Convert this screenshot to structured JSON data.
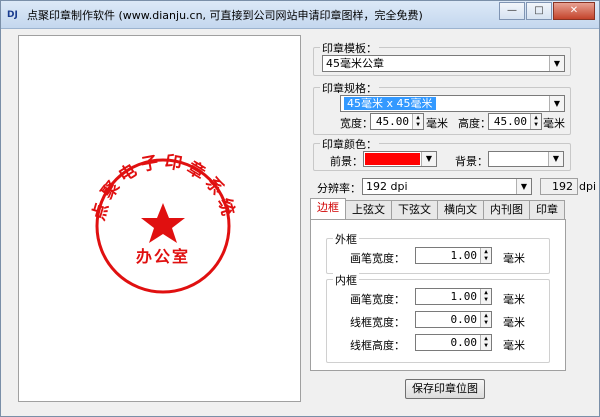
{
  "window": {
    "app_icon": "DJ",
    "title": "点聚印章制作软件 (www.dianju.cn, 可直接到公司网站申请印章图样，完全免费)",
    "minimize_icon": "minimize-icon",
    "maximize_icon": "maximize-icon",
    "close_icon": "close-icon"
  },
  "stamp": {
    "circle_text": "点聚电子印章系统",
    "center_text": "办公室",
    "color": "#e01010"
  },
  "template": {
    "label": "印章模板：",
    "value": "45毫米公章"
  },
  "size_spec": {
    "label": "印章规格：",
    "value": "45毫米 x 45毫米",
    "width_label": "宽度：",
    "width_value": "45.00",
    "width_unit": "毫米",
    "height_label": "高度：",
    "height_value": "45.00",
    "height_unit": "毫米"
  },
  "color": {
    "label": "印章颜色：",
    "foreground_label": "前景：",
    "foreground_color": "#ff0000",
    "background_label": "背景：",
    "background_color": "#ffffff"
  },
  "resolution": {
    "label": "分辨率：",
    "value": "192 dpi",
    "readout": "192",
    "readout_unit": "dpi"
  },
  "tabs": [
    {
      "label": "边框",
      "active": true
    },
    {
      "label": "上弦文",
      "active": false
    },
    {
      "label": "下弦文",
      "active": false
    },
    {
      "label": "横向文",
      "active": false
    },
    {
      "label": "内刊图",
      "active": false
    },
    {
      "label": "印章",
      "active": false
    }
  ],
  "border_tab": {
    "outer": {
      "label": "外框",
      "pen_width_label": "画笔宽度：",
      "pen_width_value": "1.00",
      "pen_width_unit": "毫米"
    },
    "inner": {
      "label": "内框",
      "pen_width_label": "画笔宽度：",
      "pen_width_value": "1.00",
      "pen_width_unit": "毫米",
      "line_width_label": "线框宽度：",
      "line_width_value": "0.00",
      "line_width_unit": "毫米",
      "line_height_label": "线框高度：",
      "line_height_value": "0.00",
      "line_height_unit": "毫米"
    }
  },
  "save_button": "保存印章位图"
}
